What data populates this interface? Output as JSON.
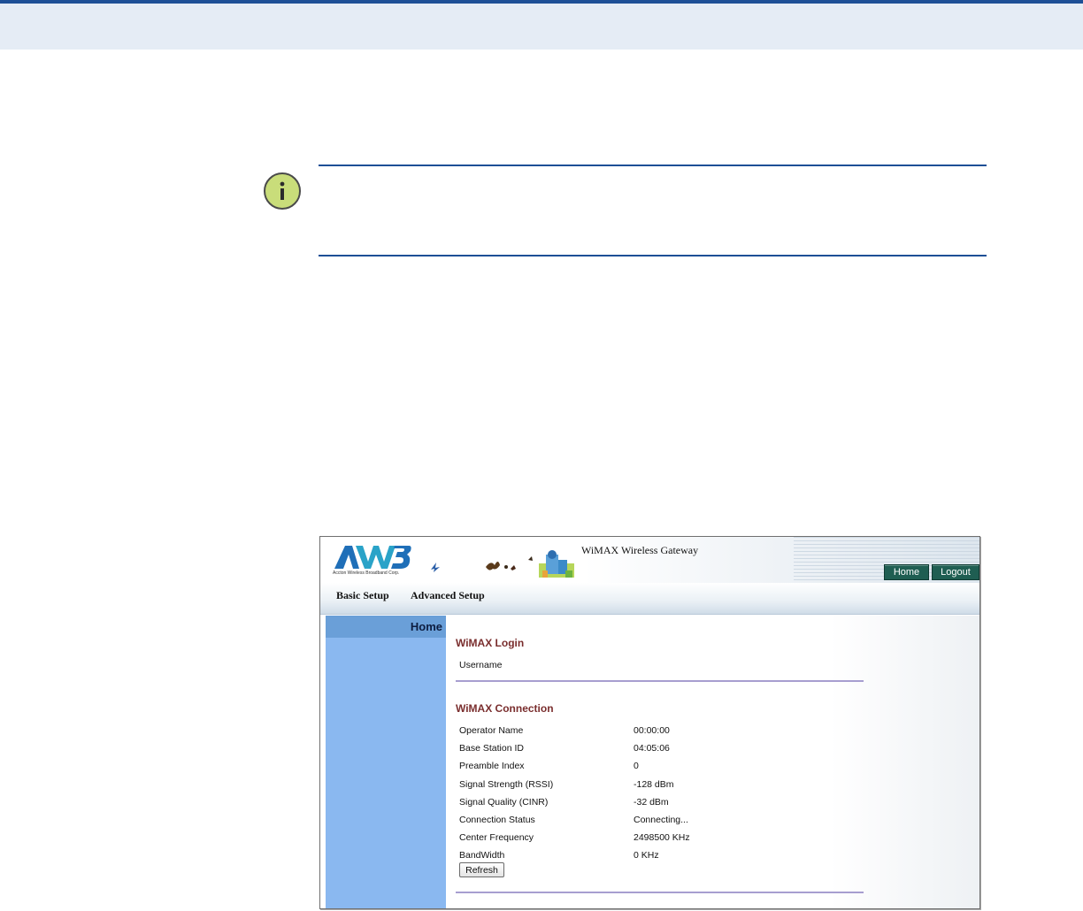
{
  "colors": {
    "doc_accent": "#1d4f96",
    "doc_band": "#e5ecf5",
    "sidebar": "#8ab8f0",
    "section_title": "#7a2e2e",
    "header_button": "#1f5e52"
  },
  "note": {
    "icon": "info-icon"
  },
  "app": {
    "logo_text": "AW3",
    "logo_subtitle": "Accton Wireless Broadband Corp.",
    "title": "WiMAX Wireless Gateway",
    "header_buttons": {
      "home": "Home",
      "logout": "Logout"
    },
    "menu": {
      "basic_setup": "Basic Setup",
      "advanced_setup": "Advanced Setup"
    },
    "sidebar": {
      "active_item": "Home"
    },
    "login": {
      "title": "WiMAX Login",
      "username_label": "Username"
    },
    "connection": {
      "title": "WiMAX Connection",
      "rows": [
        {
          "label": "Operator Name",
          "value": "00:00:00"
        },
        {
          "label": "Base Station ID",
          "value": "04:05:06"
        },
        {
          "label": "Preamble Index",
          "value": "0"
        },
        {
          "label": "Signal Strength (RSSI)",
          "value": "-128 dBm"
        },
        {
          "label": "Signal Quality (CINR)",
          "value": "-32 dBm"
        },
        {
          "label": "Connection Status",
          "value": "Connecting..."
        },
        {
          "label": "Center Frequency",
          "value": "2498500 KHz"
        },
        {
          "label": "BandWidth",
          "value": "0 KHz"
        }
      ],
      "refresh_label": "Refresh"
    }
  }
}
